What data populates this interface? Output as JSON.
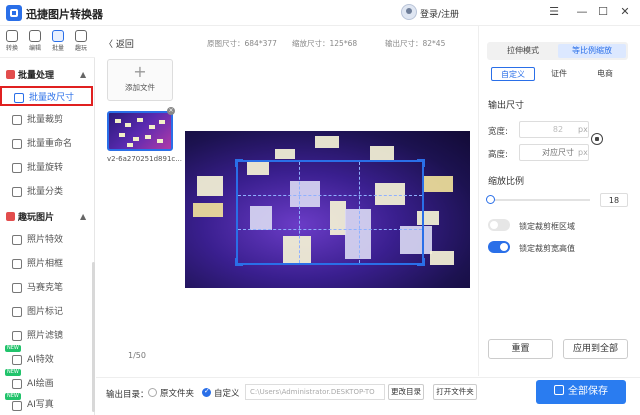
{
  "app": {
    "title": "迅捷图片转换器",
    "login": "登录/注册"
  },
  "window": {
    "menu": "☰",
    "minimize": "—",
    "maximize": "☐",
    "close": "✕"
  },
  "rail": [
    {
      "label": "转换"
    },
    {
      "label": "编辑"
    },
    {
      "label": "批量"
    },
    {
      "label": "趣玩"
    }
  ],
  "sidebar": {
    "batch_heading": "批量处理",
    "batch_items": [
      "批量改尺寸",
      "批量裁剪",
      "批量重命名",
      "批量旋转",
      "批量分类"
    ],
    "fun_heading": "趣玩图片",
    "fun_items": [
      "照片特效",
      "照片相框",
      "马赛克笔",
      "图片标记",
      "照片滤镜",
      "AI特效",
      "AI绘画",
      "AI写真"
    ],
    "new_tag": "NEW"
  },
  "toolbar": {
    "back": "返回",
    "original_size": "原图尺寸：684*377",
    "scaled_size": "缩放尺寸：125*68",
    "output_size": "输出尺寸：82*45"
  },
  "files": {
    "add_label": "添加文件",
    "thumb_name": "v2-6a270251d891c...",
    "page_count": "1/50"
  },
  "panel": {
    "mode_tabs": [
      "拉伸模式",
      "等比例缩放"
    ],
    "active_mode": 1,
    "sub_tabs": [
      "自定义",
      "证件",
      "电商"
    ],
    "output_heading": "输出尺寸",
    "width_label": "宽度:",
    "width_value": "82",
    "height_label": "高度:",
    "height_placeholder": "对应尺寸",
    "unit": "px",
    "scale_heading": "缩放比例",
    "scale_value": "18",
    "lock_crop_label": "锁定裁剪框区域",
    "lock_ratio_label": "锁定裁剪宽高值",
    "reset_button": "重置",
    "apply_all_button": "应用到全部"
  },
  "bottom": {
    "output_dir_label": "输出目录：",
    "option_original": "原文件夹",
    "option_custom": "自定义",
    "path": "C:\\Users\\Administrator.DESKTOP-TO",
    "change_dir": "更改目录",
    "open_folder": "打开文件夹",
    "save_all": "全部保存"
  },
  "colors": {
    "accent": "#2a6fe8",
    "highlight_border": "#e02020"
  }
}
